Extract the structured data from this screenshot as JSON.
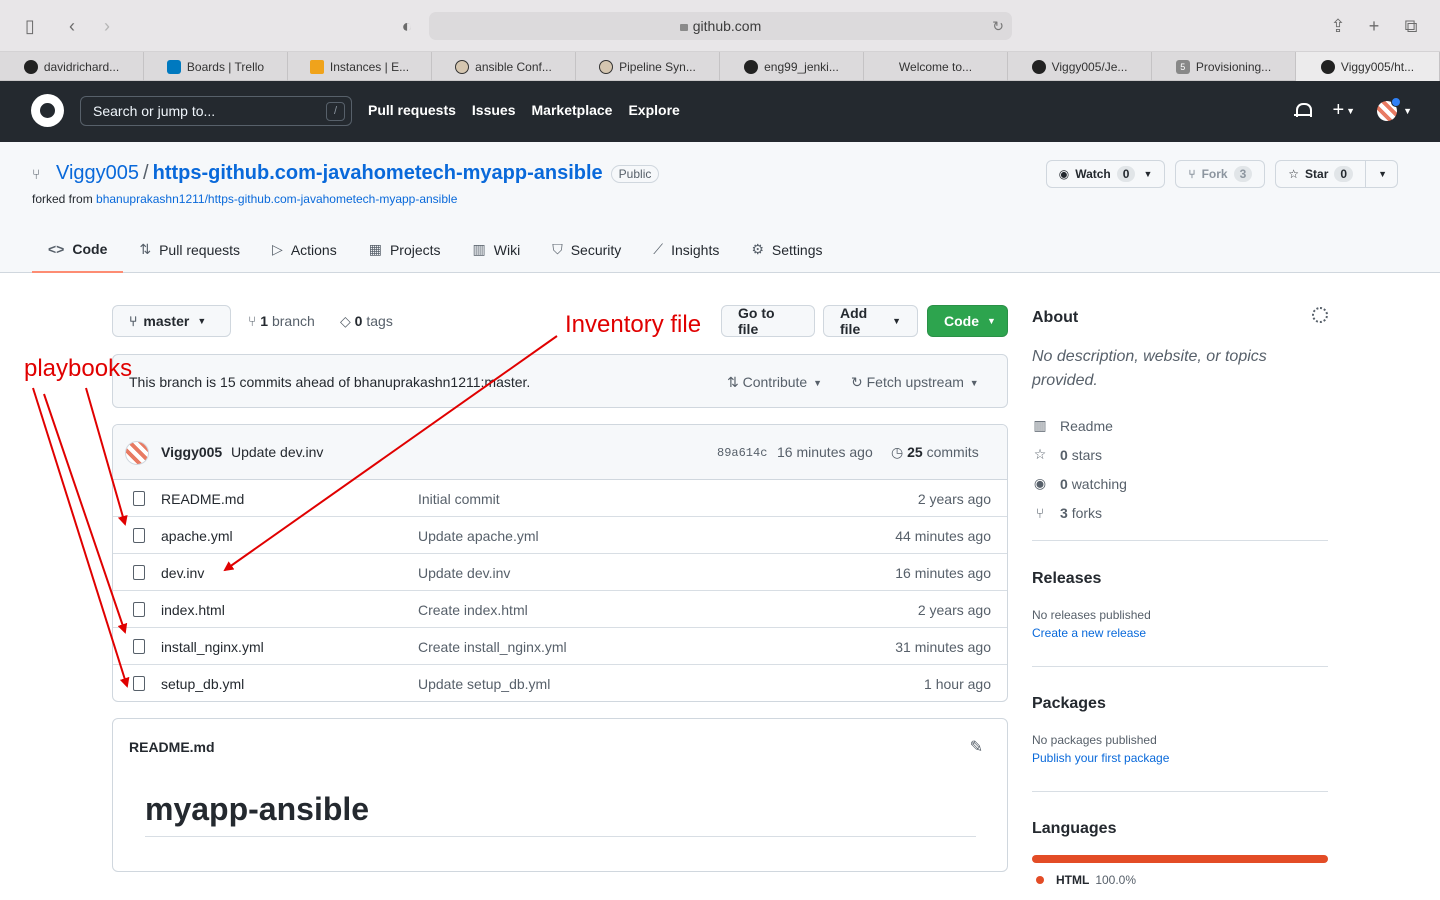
{
  "browser": {
    "url": "github.com",
    "tabs": [
      {
        "label": "davidrichard...",
        "icon": "github-icon"
      },
      {
        "label": "Boards | Trello",
        "icon": "trello-icon"
      },
      {
        "label": "Instances | E...",
        "icon": "aws-icon"
      },
      {
        "label": "ansible Conf...",
        "icon": "jenkins-icon"
      },
      {
        "label": "Pipeline Syn...",
        "icon": "jenkins-icon"
      },
      {
        "label": "eng99_jenki...",
        "icon": "github-icon"
      },
      {
        "label": "Welcome to...",
        "icon": "none"
      },
      {
        "label": "Viggy005/Je...",
        "icon": "github-icon"
      },
      {
        "label": "Provisioning...",
        "icon": "five-icon"
      },
      {
        "label": "Viggy005/ht...",
        "icon": "github-icon"
      }
    ]
  },
  "header": {
    "search_placeholder": "Search or jump to...",
    "slash": "/",
    "nav": [
      "Pull requests",
      "Issues",
      "Marketplace",
      "Explore"
    ]
  },
  "repo": {
    "owner": "Viggy005",
    "sep": "/",
    "name": "https-github.com-javahometech-myapp-ansible",
    "visibility": "Public",
    "forked_prefix": "forked from",
    "forked_from": "bhanuprakashn1211/https-github.com-javahometech-myapp-ansible",
    "watch_label": "Watch",
    "watch_count": "0",
    "fork_label": "Fork",
    "fork_count": "3",
    "star_label": "Star",
    "star_count": "0"
  },
  "tabs": [
    {
      "label": "Code",
      "icon": "code-icon"
    },
    {
      "label": "Pull requests",
      "icon": "pull-request-icon"
    },
    {
      "label": "Actions",
      "icon": "play-icon"
    },
    {
      "label": "Projects",
      "icon": "table-icon"
    },
    {
      "label": "Wiki",
      "icon": "book-icon"
    },
    {
      "label": "Security",
      "icon": "shield-icon"
    },
    {
      "label": "Insights",
      "icon": "graph-icon"
    },
    {
      "label": "Settings",
      "icon": "gear-icon"
    }
  ],
  "branch": {
    "name": "master",
    "branch_count": "1",
    "branch_word": "branch",
    "tag_count": "0",
    "tag_word": "tags",
    "go_to_file": "Go to file",
    "add_file": "Add file",
    "code": "Code"
  },
  "ahead": {
    "text": "This branch is 15 commits ahead of bhanuprakashn1211:master.",
    "contribute": "Contribute",
    "fetch": "Fetch upstream"
  },
  "latest_commit": {
    "author": "Viggy005",
    "message": "Update dev.inv",
    "sha": "89a614c",
    "ago": "16 minutes ago",
    "count": "25",
    "count_word": "commits"
  },
  "files": [
    {
      "name": "README.md",
      "message": "Initial commit",
      "age": "2 years ago"
    },
    {
      "name": "apache.yml",
      "message": "Update apache.yml",
      "age": "44 minutes ago"
    },
    {
      "name": "dev.inv",
      "message": "Update dev.inv",
      "age": "16 minutes ago"
    },
    {
      "name": "index.html",
      "message": "Create index.html",
      "age": "2 years ago"
    },
    {
      "name": "install_nginx.yml",
      "message": "Create install_nginx.yml",
      "age": "31 minutes ago"
    },
    {
      "name": "setup_db.yml",
      "message": "Update setup_db.yml",
      "age": "1 hour ago"
    }
  ],
  "readme": {
    "header": "README.md",
    "title": "myapp-ansible"
  },
  "about": {
    "heading": "About",
    "description": "No description, website, or topics provided.",
    "readme": "Readme",
    "stars_count": "0",
    "stars_word": "stars",
    "watching_count": "0",
    "watching_word": "watching",
    "forks_count": "3",
    "forks_word": "forks"
  },
  "releases": {
    "heading": "Releases",
    "none": "No releases published",
    "link": "Create a new release"
  },
  "packages": {
    "heading": "Packages",
    "none": "No packages published",
    "link": "Publish your first package"
  },
  "languages": {
    "heading": "Languages",
    "name": "HTML",
    "percent": "100.0%",
    "color": "#e34c26"
  },
  "annotations": {
    "inventory": "Inventory file",
    "playbooks": "playbooks",
    "color": "#e00000"
  }
}
